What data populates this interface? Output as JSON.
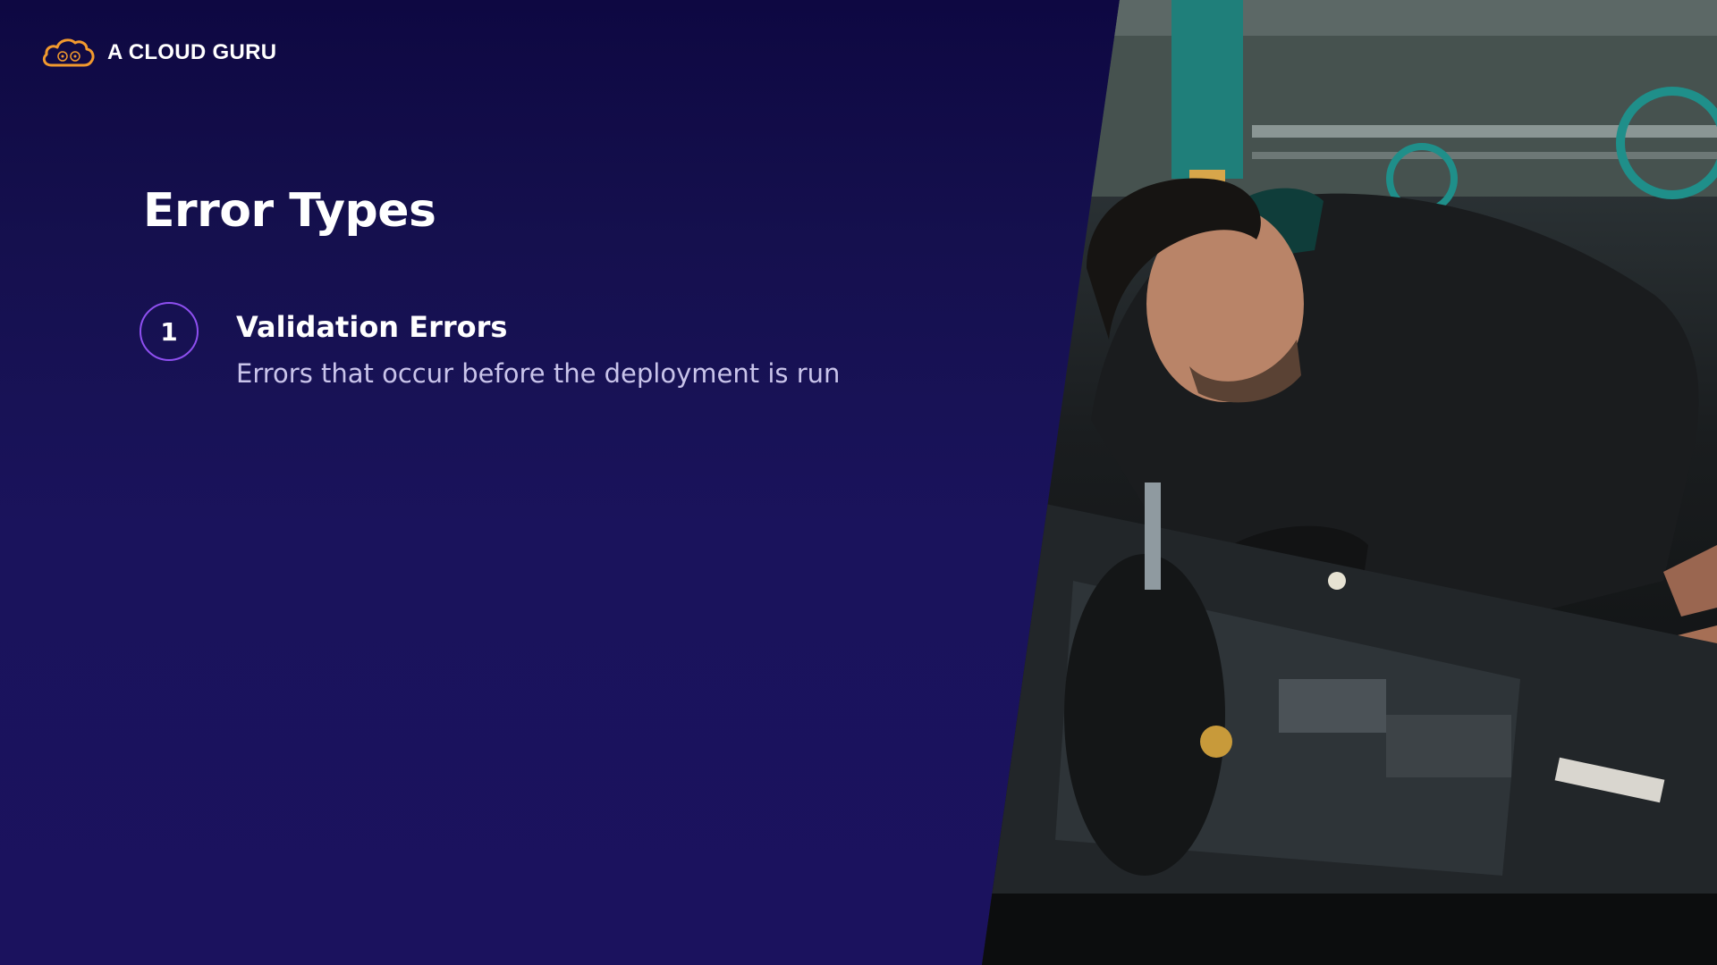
{
  "brand": {
    "name": "A CLOUD GURU",
    "icon": "cloud-logo-icon",
    "accent": "#f29a2e"
  },
  "slide": {
    "title": "Error Types"
  },
  "items": [
    {
      "number": "1",
      "title": "Validation Errors",
      "description": "Errors that occur before the deployment is run"
    }
  ],
  "colors": {
    "background": "#1b125e",
    "circle_border": "#8e4ff0",
    "description_text": "#c9c4ea"
  }
}
